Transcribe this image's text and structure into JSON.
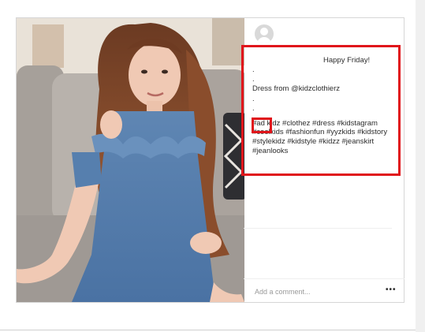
{
  "post": {
    "caption": {
      "greeting": "Happy Friday!",
      "dots_before": [
        ".",
        "."
      ],
      "credit": "Dress from @kidzclothierz",
      "dots_after": [
        ".",
        "."
      ],
      "ad_tag": "#ad",
      "hashtags": "kidz #clothez #dress #kidstagram #coolkids #fashionfun #yyzkids #kidstory #stylekidz #kidstyle #kidzz #jeanskirt #jeanlooks"
    },
    "comment_placeholder": "Add a comment...",
    "more_label": "•••",
    "highlight_color": "#e0151b"
  }
}
